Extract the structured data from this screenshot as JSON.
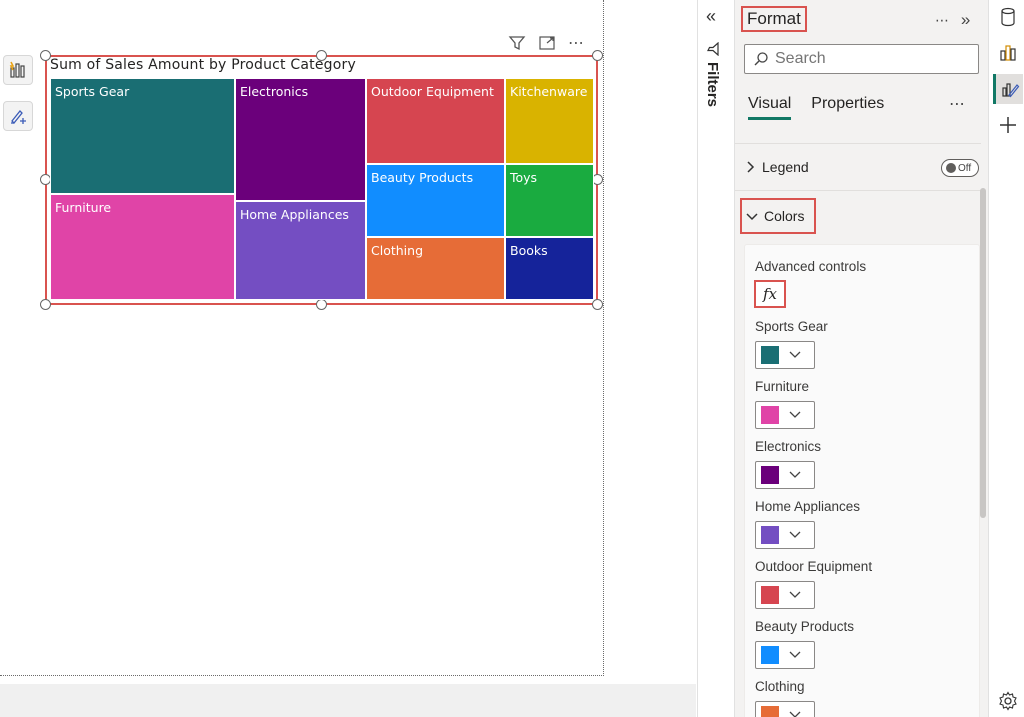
{
  "canvas": {
    "chart_title": "Sum of Sales Amount by Product Category"
  },
  "chart_data": {
    "type": "treemap",
    "title": "Sum of Sales Amount by Product Category",
    "categories": [
      "Sports Gear",
      "Furniture",
      "Electronics",
      "Home Appliances",
      "Outdoor Equipment",
      "Beauty Products",
      "Clothing",
      "Kitchenware",
      "Toys",
      "Books"
    ],
    "colors": [
      "#1a6e73",
      "#e044a7",
      "#6b007b",
      "#744ec2",
      "#d64550",
      "#118dff",
      "#e66c37",
      "#d9b300",
      "#1aab40",
      "#15239a"
    ]
  },
  "filters": {
    "label": "Filters"
  },
  "format_pane": {
    "title": "Format",
    "search_placeholder": "Search",
    "tabs": [
      "Visual",
      "Properties"
    ],
    "legend_label": "Legend",
    "legend_toggle": "Off",
    "colors_label": "Colors",
    "advanced_controls_label": "Advanced controls",
    "fx_label": "fx",
    "color_items": [
      {
        "label": "Sports Gear",
        "color": "#1a6e73"
      },
      {
        "label": "Furniture",
        "color": "#e044a7"
      },
      {
        "label": "Electronics",
        "color": "#6b007b"
      },
      {
        "label": "Home Appliances",
        "color": "#744ec2"
      },
      {
        "label": "Outdoor Equipment",
        "color": "#d64550"
      },
      {
        "label": "Beauty Products",
        "color": "#118dff"
      },
      {
        "label": "Clothing",
        "color": "#e66c37"
      }
    ]
  },
  "accent_color": "#117865",
  "highlight_color": "#d9534f"
}
